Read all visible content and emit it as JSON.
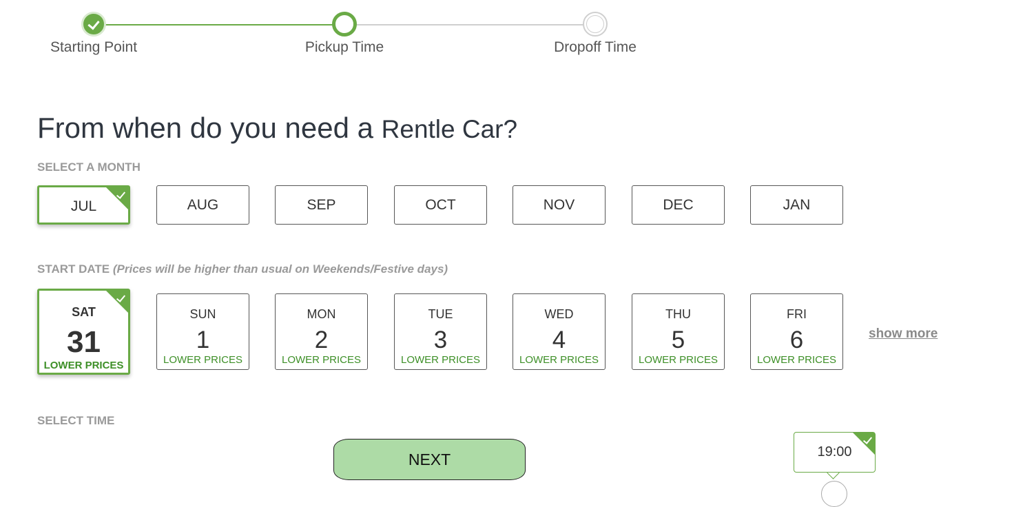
{
  "stepper": {
    "steps": [
      {
        "label": "Starting Point",
        "state": "complete"
      },
      {
        "label": "Pickup Time",
        "state": "current"
      },
      {
        "label": "Dropoff Time",
        "state": "upcoming"
      }
    ]
  },
  "heading": {
    "question": "From when do you need a ",
    "brand": "Rentle Car?"
  },
  "month_section": {
    "label": "SELECT A MONTH",
    "months": [
      "JUL",
      "AUG",
      "SEP",
      "OCT",
      "NOV",
      "DEC",
      "JAN"
    ],
    "selected": "JUL"
  },
  "date_section": {
    "label": "START DATE",
    "note": "(Prices will be higher than usual on Weekends/Festive days)",
    "dates": [
      {
        "dow": "SAT",
        "day": "31",
        "tag": "LOWER PRICES",
        "selected": true
      },
      {
        "dow": "SUN",
        "day": "1",
        "tag": "LOWER PRICES"
      },
      {
        "dow": "MON",
        "day": "2",
        "tag": "LOWER PRICES"
      },
      {
        "dow": "TUE",
        "day": "3",
        "tag": "LOWER PRICES"
      },
      {
        "dow": "WED",
        "day": "4",
        "tag": "LOWER PRICES"
      },
      {
        "dow": "THU",
        "day": "5",
        "tag": "LOWER PRICES"
      },
      {
        "dow": "FRI",
        "day": "6",
        "tag": "LOWER PRICES"
      }
    ],
    "show_more": "show more"
  },
  "time_section": {
    "label": "SELECT TIME",
    "selected_time": "19:00"
  },
  "next_button": "NEXT",
  "colors": {
    "accent": "#6aaa46",
    "promo_text": "#3d8f27",
    "next_button_bg": "#addba6",
    "muted_label": "#9a9a9a"
  }
}
